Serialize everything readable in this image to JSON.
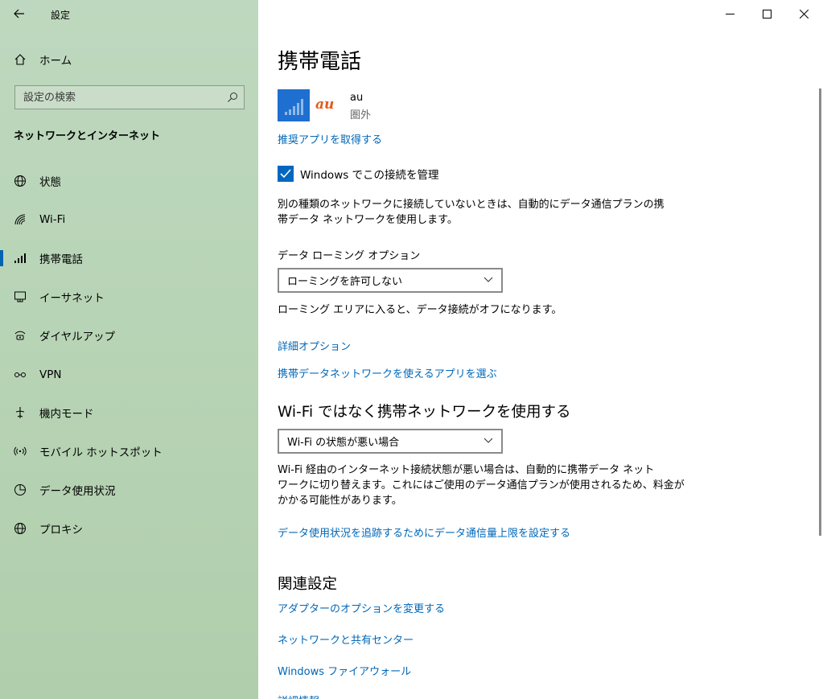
{
  "window": {
    "title": "設定",
    "controls": [
      "minimize-icon",
      "maximize-icon",
      "close-icon"
    ]
  },
  "sidebar": {
    "home_label": "ホーム",
    "search_placeholder": "設定の検索",
    "section_heading": "ネットワークとインターネット",
    "items": [
      {
        "label": "状態",
        "icon": "globe-status-icon"
      },
      {
        "label": "Wi-Fi",
        "icon": "wifi-icon"
      },
      {
        "label": "携帯電話",
        "icon": "cellular-icon",
        "active": true
      },
      {
        "label": "イーサネット",
        "icon": "ethernet-icon"
      },
      {
        "label": "ダイヤルアップ",
        "icon": "dialup-icon"
      },
      {
        "label": "VPN",
        "icon": "vpn-icon"
      },
      {
        "label": "機内モード",
        "icon": "airplane-icon"
      },
      {
        "label": "モバイル ホットスポット",
        "icon": "hotspot-icon"
      },
      {
        "label": "データ使用状況",
        "icon": "data-usage-icon"
      },
      {
        "label": "プロキシ",
        "icon": "globe-icon"
      }
    ]
  },
  "main": {
    "page_title": "携帯電話",
    "carrier": {
      "logo_text": "au",
      "name": "au",
      "status": "圏外"
    },
    "recommended_apps_link": "推奨アプリを取得する",
    "manage_checkbox": {
      "label": "Windows でこの接続を管理",
      "checked": true
    },
    "manage_description_line1": "別の種類のネットワークに接続していないときは、自動的にデータ通信プランの携",
    "manage_description_line2": "帯データ ネットワークを使用します。",
    "roaming": {
      "label": "データ ローミング オプション",
      "selected": "ローミングを許可しない",
      "description": "ローミング エリアに入ると、データ接続がオフになります。"
    },
    "advanced_options_link": "詳細オプション",
    "choose_apps_link": "携帯データネットワークを使えるアプリを選ぶ",
    "prefer_cellular": {
      "heading": "Wi-Fi ではなく携帯ネットワークを使用する",
      "selected": "Wi-Fi の状態が悪い場合",
      "description_line1": "Wi-Fi 経由のインターネット接続状態が悪い場合は、自動的に携帯データ ネット",
      "description_line2": "ワークに切り替えます。これにはご使用のデータ通信プランが使用されるため、料金が",
      "description_line3": "かかる可能性があります。"
    },
    "data_limit_link": "データ使用状況を追跡するためにデータ通信量上限を設定する",
    "related": {
      "heading": "関連設定",
      "links": [
        "アダプターのオプションを変更する",
        "ネットワークと共有センター",
        "Windows ファイアウォール",
        "詳細情報"
      ]
    }
  },
  "colors": {
    "accent": "#0067b8",
    "sidebar_bg": "#b8d4b6",
    "carrier_tile": "#1e6fd0"
  }
}
